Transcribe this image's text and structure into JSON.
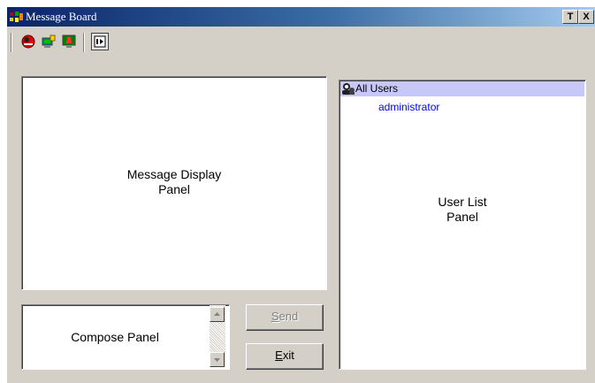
{
  "window": {
    "title": "Message Board",
    "controls": {
      "help_label": "T",
      "close_label": "X"
    }
  },
  "toolbar": {
    "tools": [
      {
        "icon": "do-not-disturb-icon"
      },
      {
        "icon": "user-screen-lock-icon"
      },
      {
        "icon": "user-screen-icon"
      },
      {
        "icon": "message-toggle-icon"
      }
    ]
  },
  "message_display": {
    "label_line1": "Message Display",
    "label_line2": "Panel"
  },
  "compose": {
    "label": "Compose Panel"
  },
  "buttons": {
    "send": {
      "label_first": "S",
      "label_rest": "end",
      "enabled": false
    },
    "exit": {
      "label_first": "E",
      "label_rest": "xit",
      "enabled": true
    }
  },
  "user_list": {
    "group_label": "All Users",
    "users": [
      "administrator"
    ],
    "label_line1": "User List",
    "label_line2": "Panel"
  },
  "colors": {
    "titlebar_start": "#0a246a",
    "titlebar_end": "#a6caf0",
    "selection_bg": "#c8c8f8",
    "user_text": "#0000ff",
    "window_face": "#d4d0c8"
  }
}
